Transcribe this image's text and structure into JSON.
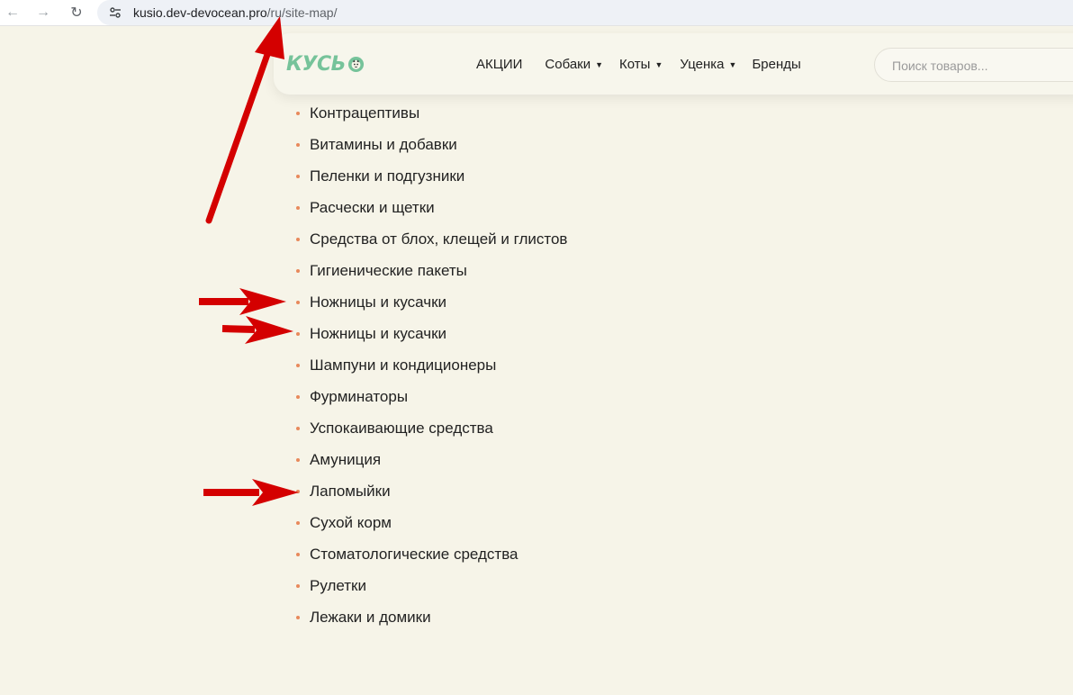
{
  "browser": {
    "back_icon": "arrow-left-icon",
    "forward_icon": "arrow-right-icon",
    "reload_icon": "reload-icon",
    "site_info_icon": "tune-icon",
    "url_host": "kusio.dev-devocean.pro",
    "url_path": "/ru/site-map/"
  },
  "header": {
    "logo_text": "КУСЬ",
    "nav": [
      {
        "label": "АКЦИИ",
        "has_dropdown": false
      },
      {
        "label": "Собаки",
        "has_dropdown": true
      },
      {
        "label": "Коты",
        "has_dropdown": true
      },
      {
        "label": "Уценка",
        "has_dropdown": true
      },
      {
        "label": "Бренды",
        "has_dropdown": false
      }
    ],
    "search_placeholder": "Поиск товаров..."
  },
  "sitemap": {
    "items": [
      "Контрацептивы",
      "Витамины и добавки",
      "Пеленки и подгузники",
      "Расчески и щетки",
      "Средства от блох, клещей и глистов",
      "Гигиенические пакеты",
      "Ножницы и кусачки",
      "Ножницы и кусачки",
      "Шампуни и кондиционеры",
      "Фурминаторы",
      "Успокаивающие средства",
      "Амуниция",
      "Лапомыйки",
      "Сухой корм",
      "Стоматологические средства",
      "Рулетки",
      "Лежаки и домики"
    ]
  },
  "colors": {
    "page_background": "#f6f4e8",
    "logo_green": "#76c39a",
    "bullet_orange": "#e8895b",
    "annotation_red": "#d40000"
  }
}
